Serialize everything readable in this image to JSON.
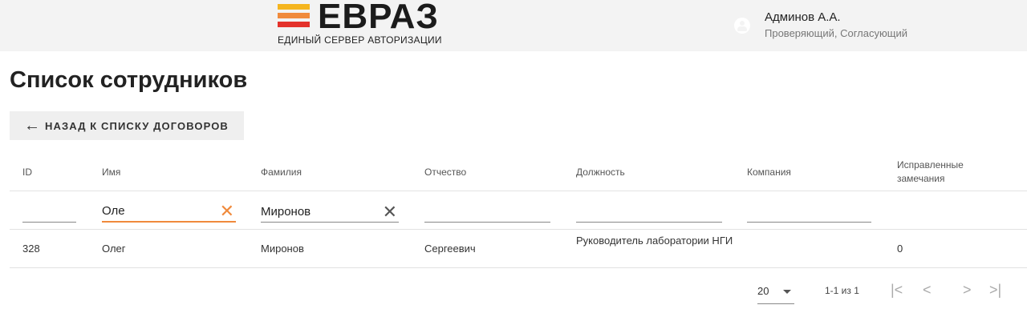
{
  "brand": {
    "logo_text": "ЕВРАЗ",
    "subtitle": "ЕДИНЫЙ СЕРВЕР АВТОРИЗАЦИИ",
    "colors": {
      "bar_top": "#f5b51f",
      "bar_mid": "#f08a3c",
      "bar_bot": "#e4322b"
    }
  },
  "user": {
    "icon": "account-icon",
    "name": "Админов А.А.",
    "roles": "Проверяющий, Согласующий"
  },
  "page": {
    "title": "Список сотрудников",
    "back_button": {
      "icon": "arrow-left-icon",
      "label": "НАЗАД К СПИСКУ ДОГОВОРОВ"
    }
  },
  "table": {
    "columns": {
      "id": "ID",
      "first_name": "Имя",
      "last_name": "Фамилия",
      "patronymic": "Отчество",
      "position": "Должность",
      "company": "Компания",
      "fixed_remarks": "Исправленные замечания"
    },
    "filters": {
      "id": "",
      "first_name": "Оле",
      "last_name": "Миронов",
      "patronymic": "",
      "position": "",
      "company": ""
    },
    "rows": [
      {
        "id": "328",
        "first_name": "Олег",
        "last_name": "Миронов",
        "patronymic": "Сергеевич",
        "position": "Руководитель лаборатории НГИ",
        "company": "",
        "fixed_remarks": "0"
      }
    ]
  },
  "paginator": {
    "page_size": "20",
    "range_label": "1-1 из 1",
    "first": "|<",
    "prev": "<",
    "next": ">",
    "last": ">|"
  },
  "colors": {
    "accent": "#f08a3c",
    "header_bg": "#f3f3f3",
    "button_bg": "#efefef"
  }
}
